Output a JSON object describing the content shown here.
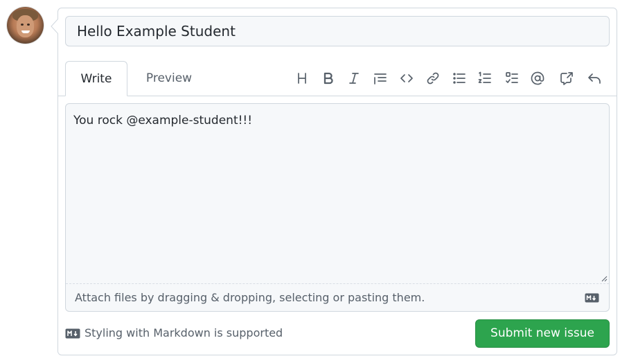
{
  "issue": {
    "title_value": "Hello Example Student",
    "body_value": "You rock @example-student!!!"
  },
  "tabs": {
    "write_label": "Write",
    "preview_label": "Preview"
  },
  "toolbar": {
    "icons": [
      "heading-icon",
      "bold-icon",
      "italic-icon",
      "quote-icon",
      "code-icon",
      "link-icon",
      "bulleted-list-icon",
      "numbered-list-icon",
      "task-list-icon",
      "mention-icon",
      "cross-reference-icon",
      "reply-icon"
    ]
  },
  "editor": {
    "attach_hint": "Attach files by dragging & dropping, selecting or pasting them."
  },
  "footer": {
    "markdown_note": "Styling with Markdown is supported",
    "submit_label": "Submit new issue"
  },
  "colors": {
    "primary_button": "#2da44e",
    "border": "#d0d7de",
    "muted_text": "#57606a"
  }
}
